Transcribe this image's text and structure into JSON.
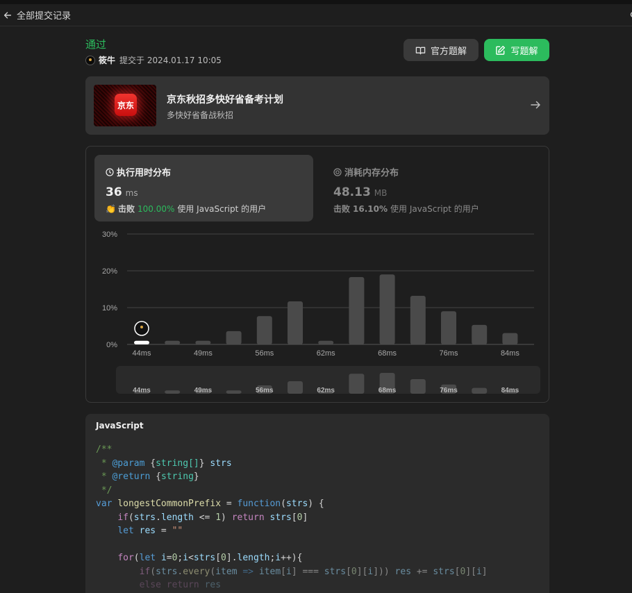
{
  "nav": {
    "back_label": "全部提交记录"
  },
  "submission": {
    "status": "通过",
    "username": "筱牛",
    "submitted_at": "提交于 2024.01.17 10:05"
  },
  "actions": {
    "official_solution_label": "官方题解",
    "write_solution_label": "写题解"
  },
  "banner": {
    "logo_text": "京东",
    "title": "京东秋招多快好省备考计划",
    "subtitle": "多快好省备战秋招"
  },
  "runtime": {
    "title": "执行用时分布",
    "value": "36",
    "unit": "ms",
    "beat_word": "击败",
    "beat_percent": "100.00%",
    "beat_suffix": "使用 JavaScript 的用户"
  },
  "memory": {
    "title": "消耗内存分布",
    "value": "48.13",
    "unit": "MB",
    "beat_word": "击败",
    "beat_percent": "16.10%",
    "beat_suffix": "使用 JavaScript 的用户"
  },
  "colors": {
    "accent_green": "#2cbb5d",
    "bar": "#4a4a4a",
    "highlight_bar": "#ffffff"
  },
  "chart_data": {
    "type": "bar",
    "x": [
      44,
      46,
      49,
      51,
      56,
      59,
      62,
      64,
      68,
      70,
      76,
      78,
      84
    ],
    "values": [
      1.0,
      1.0,
      1.0,
      3.6,
      7.7,
      11.7,
      1.0,
      18.3,
      19.0,
      13.2,
      9.0,
      5.3,
      3.1
    ],
    "highlight_index": 0,
    "tick_labels": [
      "44ms",
      "49ms",
      "56ms",
      "62ms",
      "68ms",
      "76ms",
      "84ms"
    ],
    "y_ticks": [
      "30%",
      "20%",
      "10%",
      "0%"
    ],
    "ylim": [
      0,
      30
    ],
    "grid": true,
    "overview": {
      "tick_labels": [
        "44ms",
        "49ms",
        "56ms",
        "62ms",
        "68ms",
        "76ms",
        "84ms"
      ],
      "values": [
        0.5,
        0.8,
        0.8,
        0.8,
        2.0,
        3.0,
        0.5,
        4.8,
        5.0,
        3.5,
        2.2,
        1.4,
        0.8
      ]
    }
  },
  "code": {
    "language": "JavaScript",
    "lines": [
      [
        {
          "t": "/**",
          "c": "comment"
        }
      ],
      [
        {
          "t": " * ",
          "c": "comment"
        },
        {
          "t": "@param",
          "c": "tag"
        },
        {
          "t": " {",
          "c": "plain"
        },
        {
          "t": "string[]",
          "c": "type"
        },
        {
          "t": "} ",
          "c": "plain"
        },
        {
          "t": "strs",
          "c": "param"
        }
      ],
      [
        {
          "t": " * ",
          "c": "comment"
        },
        {
          "t": "@return",
          "c": "tag"
        },
        {
          "t": " {",
          "c": "plain"
        },
        {
          "t": "string",
          "c": "type"
        },
        {
          "t": "}",
          "c": "plain"
        }
      ],
      [
        {
          "t": " */",
          "c": "comment"
        }
      ],
      [
        {
          "t": "var ",
          "c": "kw"
        },
        {
          "t": "longestCommonPrefix",
          "c": "fn"
        },
        {
          "t": " = ",
          "c": "plain"
        },
        {
          "t": "function",
          "c": "kw"
        },
        {
          "t": "(",
          "c": "plain"
        },
        {
          "t": "strs",
          "c": "param"
        },
        {
          "t": ") {",
          "c": "plain"
        }
      ],
      [
        {
          "t": "    ",
          "c": "plain"
        },
        {
          "t": "if",
          "c": "ctrl"
        },
        {
          "t": "(",
          "c": "plain"
        },
        {
          "t": "strs",
          "c": "param"
        },
        {
          "t": ".",
          "c": "plain"
        },
        {
          "t": "length",
          "c": "prop"
        },
        {
          "t": " <= ",
          "c": "plain"
        },
        {
          "t": "1",
          "c": "num"
        },
        {
          "t": ") ",
          "c": "plain"
        },
        {
          "t": "return",
          "c": "ctrl"
        },
        {
          "t": " ",
          "c": "plain"
        },
        {
          "t": "strs",
          "c": "param"
        },
        {
          "t": "[",
          "c": "plain"
        },
        {
          "t": "0",
          "c": "num"
        },
        {
          "t": "]",
          "c": "plain"
        }
      ],
      [
        {
          "t": "    ",
          "c": "plain"
        },
        {
          "t": "let",
          "c": "kw"
        },
        {
          "t": " ",
          "c": "plain"
        },
        {
          "t": "res",
          "c": "param"
        },
        {
          "t": " = ",
          "c": "plain"
        },
        {
          "t": "\"\"",
          "c": "str"
        }
      ],
      [
        {
          "t": "",
          "c": "plain"
        }
      ],
      [
        {
          "t": "    ",
          "c": "plain"
        },
        {
          "t": "for",
          "c": "ctrl"
        },
        {
          "t": "(",
          "c": "plain"
        },
        {
          "t": "let",
          "c": "kw"
        },
        {
          "t": " ",
          "c": "plain"
        },
        {
          "t": "i",
          "c": "param"
        },
        {
          "t": "=",
          "c": "plain"
        },
        {
          "t": "0",
          "c": "num"
        },
        {
          "t": ";",
          "c": "plain"
        },
        {
          "t": "i",
          "c": "param"
        },
        {
          "t": "<",
          "c": "plain"
        },
        {
          "t": "strs",
          "c": "param"
        },
        {
          "t": "[",
          "c": "plain"
        },
        {
          "t": "0",
          "c": "num"
        },
        {
          "t": "].",
          "c": "plain"
        },
        {
          "t": "length",
          "c": "prop"
        },
        {
          "t": ";",
          "c": "plain"
        },
        {
          "t": "i",
          "c": "param"
        },
        {
          "t": "++){",
          "c": "plain"
        }
      ],
      [
        {
          "t": "        ",
          "c": "plain"
        },
        {
          "t": "if",
          "c": "ctrl"
        },
        {
          "t": "(",
          "c": "plain"
        },
        {
          "t": "strs",
          "c": "param"
        },
        {
          "t": ".",
          "c": "plain"
        },
        {
          "t": "every",
          "c": "fn"
        },
        {
          "t": "(",
          "c": "plain"
        },
        {
          "t": "item",
          "c": "param"
        },
        {
          "t": " => ",
          "c": "kw"
        },
        {
          "t": "item",
          "c": "param"
        },
        {
          "t": "[",
          "c": "plain"
        },
        {
          "t": "i",
          "c": "param"
        },
        {
          "t": "] === ",
          "c": "plain"
        },
        {
          "t": "strs",
          "c": "param"
        },
        {
          "t": "[",
          "c": "plain"
        },
        {
          "t": "0",
          "c": "num"
        },
        {
          "t": "][",
          "c": "plain"
        },
        {
          "t": "i",
          "c": "param"
        },
        {
          "t": "])) ",
          "c": "plain"
        },
        {
          "t": "res",
          "c": "param"
        },
        {
          "t": " += ",
          "c": "plain"
        },
        {
          "t": "strs",
          "c": "param"
        },
        {
          "t": "[",
          "c": "plain"
        },
        {
          "t": "0",
          "c": "num"
        },
        {
          "t": "][",
          "c": "plain"
        },
        {
          "t": "i",
          "c": "param"
        },
        {
          "t": "]",
          "c": "plain"
        }
      ],
      [
        {
          "t": "        ",
          "c": "plain"
        },
        {
          "t": "else",
          "c": "ctrl"
        },
        {
          "t": " ",
          "c": "plain"
        },
        {
          "t": "return",
          "c": "ctrl"
        },
        {
          "t": " ",
          "c": "plain"
        },
        {
          "t": "res",
          "c": "param"
        }
      ]
    ]
  }
}
